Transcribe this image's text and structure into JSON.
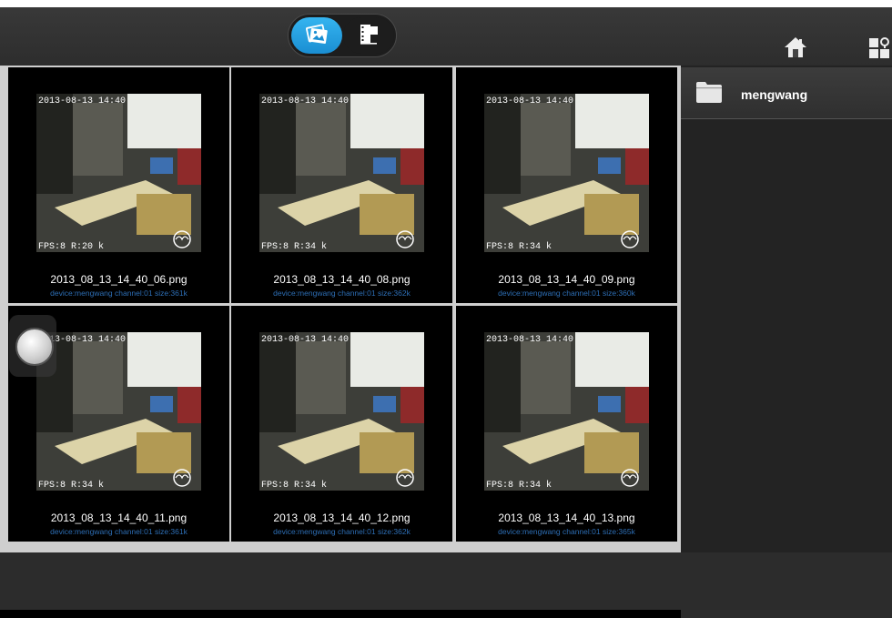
{
  "toolbar": {
    "tab_photos": "photos",
    "tab_videos": "videos",
    "home": "home",
    "menu": "grid-settings"
  },
  "gallery": {
    "items": [
      {
        "filename": "2013_08_13_14_40_06.png",
        "meta": "device:mengwang  channel:01  size:361k",
        "osd_time": "2013-08-13 14:40",
        "osd_stats": "FPS:8  R:20 k"
      },
      {
        "filename": "2013_08_13_14_40_08.png",
        "meta": "device:mengwang  channel:01  size:362k",
        "osd_time": "2013-08-13 14:40",
        "osd_stats": "FPS:8  R:34 k"
      },
      {
        "filename": "2013_08_13_14_40_09.png",
        "meta": "device:mengwang  channel:01  size:360k",
        "osd_time": "2013-08-13 14:40",
        "osd_stats": "FPS:8  R:34 k"
      },
      {
        "filename": "2013_08_13_14_40_11.png",
        "meta": "device:mengwang  channel:01  size:361k",
        "osd_time": "2013-08-13 14:40",
        "osd_stats": "FPS:8  R:34 k"
      },
      {
        "filename": "2013_08_13_14_40_12.png",
        "meta": "device:mengwang  channel:01  size:362k",
        "osd_time": "2013-08-13 14:40",
        "osd_stats": "FPS:8  R:34 k"
      },
      {
        "filename": "2013_08_13_14_40_13.png",
        "meta": "device:mengwang  channel:01  size:365k",
        "osd_time": "2013-08-13 14:40",
        "osd_stats": "FPS:8  R:34 k"
      }
    ]
  },
  "panel": {
    "folders": [
      {
        "name": "mengwang"
      }
    ]
  },
  "colors": {
    "accent": "#1e9be0",
    "meta_text": "#2d6eb5"
  }
}
